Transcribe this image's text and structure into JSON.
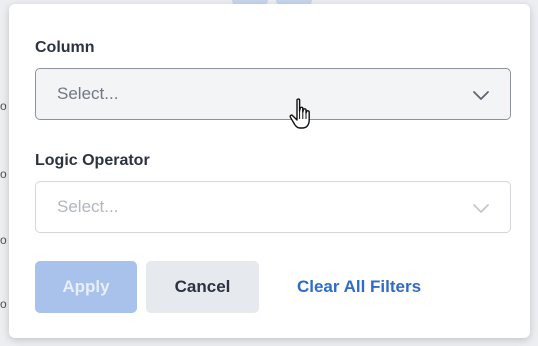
{
  "background": {
    "row_markers": [
      "o",
      "o",
      "o",
      "o"
    ]
  },
  "filter_panel": {
    "column": {
      "label": "Column",
      "placeholder": "Select..."
    },
    "logic_operator": {
      "label": "Logic Operator",
      "placeholder": "Select..."
    },
    "buttons": {
      "apply": "Apply",
      "cancel": "Cancel",
      "clear_all": "Clear All Filters"
    }
  },
  "colors": {
    "accent": "#2f6bc9",
    "apply_disabled": "#a9c2ec",
    "cancel_bg": "#e6e9ed"
  }
}
